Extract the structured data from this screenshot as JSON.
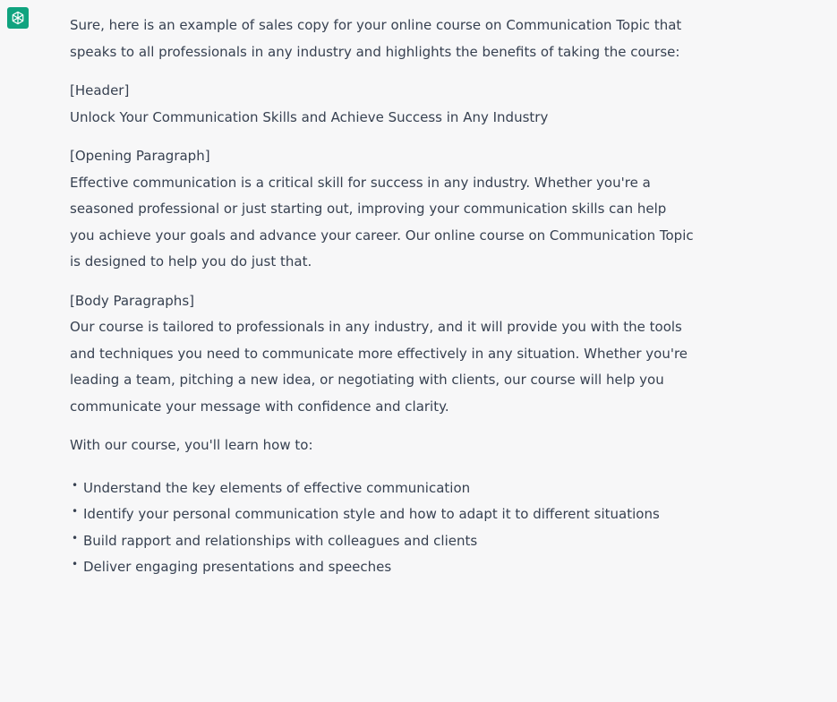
{
  "message": {
    "intro": [
      "Sure, here is an example of sales copy for your online course on Communication Topic that",
      "speaks to all professionals in any industry and highlights the benefits of taking the course:"
    ],
    "header_tag": "[Header]",
    "header_text": "Unlock Your Communication Skills and Achieve Success in Any Industry",
    "opening_tag": "[Opening Paragraph]",
    "opening_lines": [
      "Effective communication is a critical skill for success in any industry. Whether you're a",
      "seasoned professional or just starting out, improving your communication skills can help",
      "you achieve your goals and advance your career. Our online course on Communication Topic",
      "is designed to help you do just that."
    ],
    "body_tag": "[Body Paragraphs]",
    "body_lines": [
      "Our course is tailored to professionals in any industry, and it will provide you with the tools",
      "and techniques you need to communicate more effectively in any situation. Whether you're",
      "leading a team, pitching a new idea, or negotiating with clients, our course will help you",
      "communicate your message with confidence and clarity."
    ],
    "learn_intro": "With our course, you'll learn how to:",
    "bullet_glyph": "•",
    "bullets": [
      "Understand the key elements of effective communication",
      "Identify your personal communication style and how to adapt it to different situations",
      "Build rapport and relationships with colleagues and clients",
      "Deliver engaging presentations and speeches"
    ]
  },
  "colors": {
    "background": "#f7f7f8",
    "text": "#374151",
    "avatar": "#10a37f"
  },
  "icons": {
    "avatar": "assistant-logo-icon"
  }
}
